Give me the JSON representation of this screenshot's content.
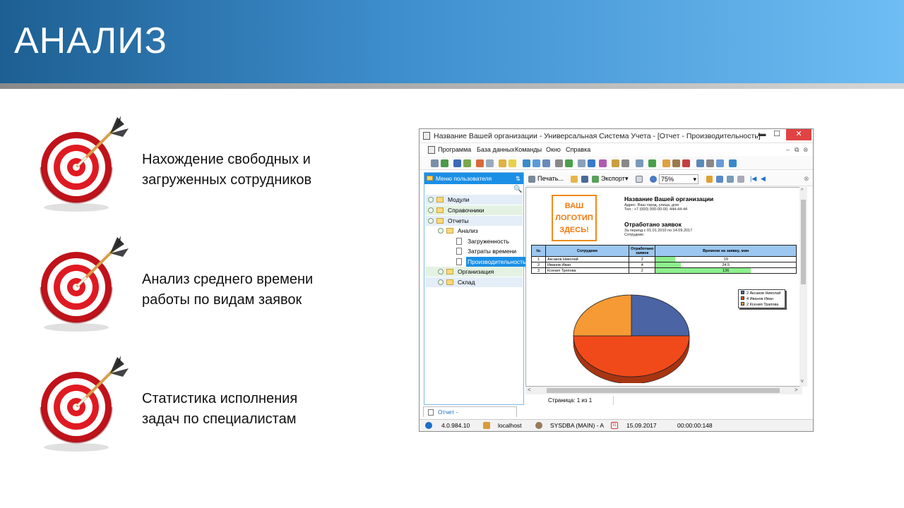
{
  "slide": {
    "title": "АНАЛИЗ",
    "bullets": [
      {
        "line1": "Нахождение свободных и",
        "line2": "загруженных сотрудников"
      },
      {
        "line1": "Анализ среднего времени",
        "line2": "работы по видам заявок"
      },
      {
        "line1": "Статистика исполнения",
        "line2": "задач по специалистам"
      }
    ]
  },
  "window": {
    "title": "Название Вашей организации - Универсальная Система Учета - [Отчет - Производительность]",
    "minimize": "▬",
    "maximize": "☐",
    "close": "✕",
    "menu": [
      "Программа",
      "База данных",
      "Команды",
      "Окно",
      "Справка"
    ]
  },
  "sidebar": {
    "header": "Меню пользователя",
    "pin": "⇅",
    "items": [
      {
        "label": "Модули",
        "level": 0,
        "kind": "folder",
        "expanded": false
      },
      {
        "label": "Справочники",
        "level": 0,
        "kind": "folder",
        "expanded": false
      },
      {
        "label": "Отчеты",
        "level": 0,
        "kind": "folder",
        "expanded": true
      },
      {
        "label": "Анализ",
        "level": 1,
        "kind": "folder",
        "expanded": true
      },
      {
        "label": "Загруженность",
        "level": 2,
        "kind": "doc"
      },
      {
        "label": "Затраты времени",
        "level": 2,
        "kind": "doc"
      },
      {
        "label": "Производительность",
        "level": 2,
        "kind": "doc",
        "selected": true
      },
      {
        "label": "Организация",
        "level": 1,
        "kind": "folder",
        "expanded": false
      },
      {
        "label": "Склад",
        "level": 1,
        "kind": "folder",
        "expanded": false
      }
    ]
  },
  "report_toolbar": {
    "print_label": "Печать...",
    "export_label": "Экспорт",
    "zoom_value": "75%"
  },
  "report": {
    "logo_lines": [
      "ВАШ",
      "ЛОГОТИП",
      "ЗДЕСЬ!"
    ],
    "org_name": "Название Вашей организации",
    "address": "Адрес: Ваш город, улица, дом",
    "phone": "Тел.: +7 (000) 000-00-00, 444-44-44",
    "title": "Отработано заявок",
    "period": "За период с 01.01.2010 по 14.09.2017",
    "employee_label": "Сотрудник:",
    "columns": [
      "№",
      "Сотрудник",
      "Отработано заявок",
      "Времени на заявку, мин"
    ],
    "rows": [
      {
        "n": "1",
        "name": "Аксаков Николай",
        "count": "2",
        "time": "19",
        "fraction": 0.14
      },
      {
        "n": "2",
        "name": "Иванов Иван",
        "count": "4",
        "time": "24.5",
        "fraction": 0.18
      },
      {
        "n": "3",
        "name": "Ксения Тряпова",
        "count": "2",
        "time": "136",
        "fraction": 0.68
      }
    ],
    "legend": [
      "2 Аксаков Николай",
      "4 Иванов Иван",
      "2 Ксения Трапова"
    ],
    "page_label": "Страница: 1 из 1"
  },
  "chart_data": {
    "type": "pie",
    "categories": [
      "2 Аксаков Николай",
      "4 Иванов Иван",
      "2 Ксения Трапова"
    ],
    "values": [
      2,
      4,
      2
    ],
    "colors": [
      "#4a64a4",
      "#f04a1a",
      "#f59a34"
    ]
  },
  "tabs": {
    "active": "Отчет - Производительность"
  },
  "statusbar": {
    "version": "4.0.984.10",
    "host": "localhost",
    "user": "SYSDBA (MAIN) - A",
    "date_icon": "31",
    "date": "15.09.2017",
    "timer": "00:00:00:148"
  },
  "colors": {
    "banner_start": "#1d5f92",
    "banner_end": "#6ebdf3",
    "accent": "#1b8fe6",
    "close": "#e04343"
  }
}
